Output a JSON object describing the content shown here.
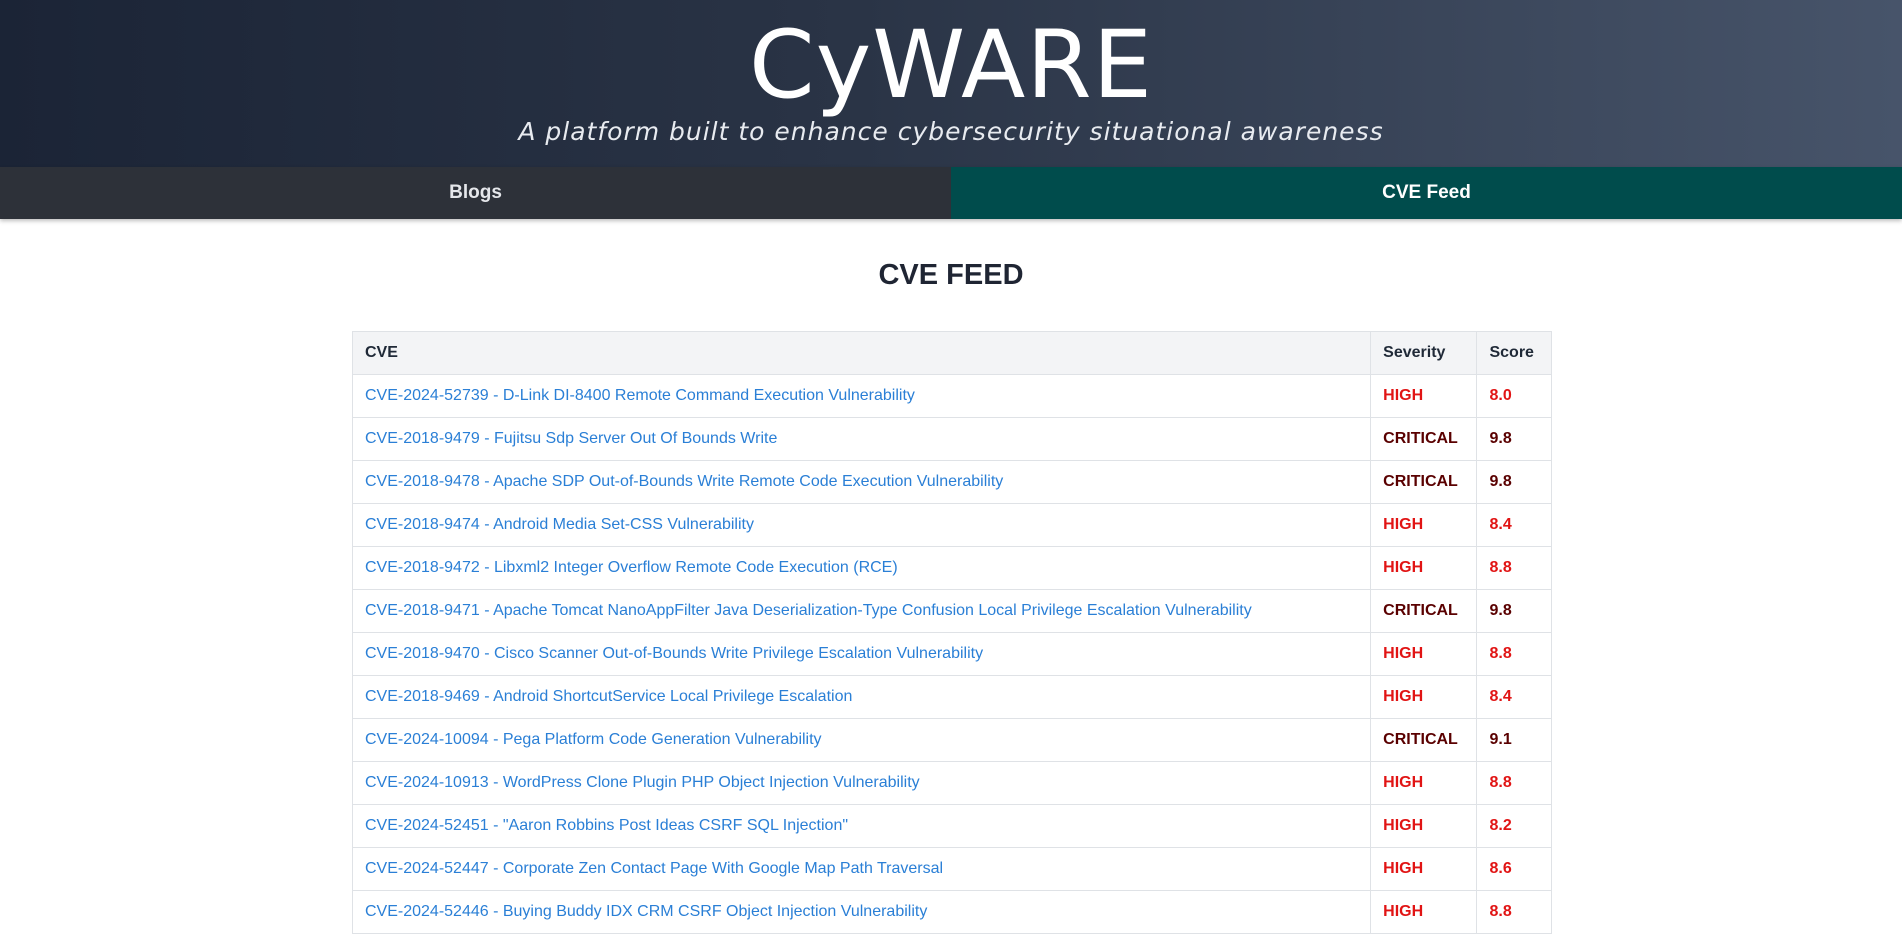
{
  "header": {
    "brand": "CyWARE",
    "tagline": "A platform built to enhance cybersecurity situational awareness"
  },
  "nav": {
    "items": [
      {
        "label": "Blogs",
        "active": false
      },
      {
        "label": "CVE Feed",
        "active": true
      }
    ]
  },
  "main": {
    "heading": "CVE FEED",
    "table": {
      "columns": [
        "CVE",
        "Severity",
        "Score"
      ],
      "rows": [
        {
          "cve": "CVE-2024-52739 - D-Link DI-8400 Remote Command Execution Vulnerability",
          "severity": "HIGH",
          "score": "8.0"
        },
        {
          "cve": "CVE-2018-9479 - Fujitsu Sdp Server Out Of Bounds Write",
          "severity": "CRITICAL",
          "score": "9.8"
        },
        {
          "cve": "CVE-2018-9478 - Apache SDP Out-of-Bounds Write Remote Code Execution Vulnerability",
          "severity": "CRITICAL",
          "score": "9.8"
        },
        {
          "cve": "CVE-2018-9474 - Android Media Set-CSS Vulnerability",
          "severity": "HIGH",
          "score": "8.4"
        },
        {
          "cve": "CVE-2018-9472 - Libxml2 Integer Overflow Remote Code Execution (RCE)",
          "severity": "HIGH",
          "score": "8.8"
        },
        {
          "cve": "CVE-2018-9471 - Apache Tomcat NanoAppFilter Java Deserialization-Type Confusion Local Privilege Escalation Vulnerability",
          "severity": "CRITICAL",
          "score": "9.8"
        },
        {
          "cve": "CVE-2018-9470 - Cisco Scanner Out-of-Bounds Write Privilege Escalation Vulnerability",
          "severity": "HIGH",
          "score": "8.8"
        },
        {
          "cve": "CVE-2018-9469 - Android ShortcutService Local Privilege Escalation",
          "severity": "HIGH",
          "score": "8.4"
        },
        {
          "cve": "CVE-2024-10094 - Pega Platform Code Generation Vulnerability",
          "severity": "CRITICAL",
          "score": "9.1"
        },
        {
          "cve": "CVE-2024-10913 - WordPress Clone Plugin PHP Object Injection Vulnerability",
          "severity": "HIGH",
          "score": "8.8"
        },
        {
          "cve": "CVE-2024-52451 - \"Aaron Robbins Post Ideas CSRF SQL Injection\"",
          "severity": "HIGH",
          "score": "8.2"
        },
        {
          "cve": "CVE-2024-52447 - Corporate Zen Contact Page With Google Map Path Traversal",
          "severity": "HIGH",
          "score": "8.6"
        },
        {
          "cve": "CVE-2024-52446 - Buying Buddy IDX CRM CSRF Object Injection Vulnerability",
          "severity": "HIGH",
          "score": "8.8"
        }
      ]
    }
  },
  "colors": {
    "high": "#e11414",
    "critical": "#5a0000",
    "link": "#2a7fd6",
    "nav_active": "#004c4c",
    "nav_inactive": "#2d3139"
  }
}
